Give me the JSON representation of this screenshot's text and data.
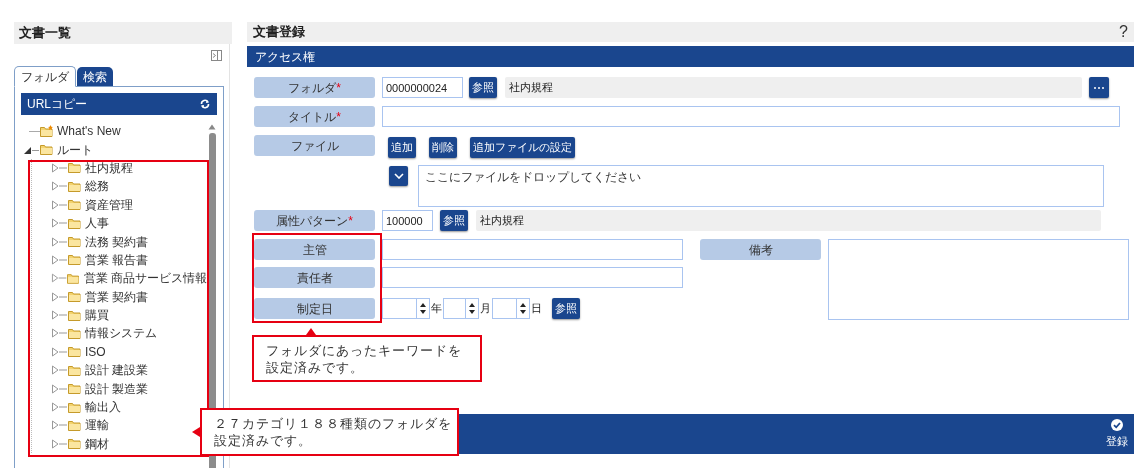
{
  "left_panel": {
    "title": "文書一覧",
    "tabs": [
      {
        "label": "フォルダ",
        "selected": true
      },
      {
        "label": "検索",
        "selected": false
      }
    ],
    "toolbar": {
      "label": "URLコピー"
    },
    "tree": [
      {
        "label": "What's New",
        "kind": "new"
      },
      {
        "label": "ルート",
        "kind": "folder",
        "expanded": true,
        "children": [
          {
            "label": "社内規程",
            "kind": "folder",
            "expanded": false
          },
          {
            "label": "総務",
            "kind": "folder",
            "expanded": false
          },
          {
            "label": "資産管理",
            "kind": "folder",
            "expanded": false
          },
          {
            "label": "人事",
            "kind": "folder",
            "expanded": false
          },
          {
            "label": "法務 契約書",
            "kind": "folder",
            "expanded": false
          },
          {
            "label": "営業 報告書",
            "kind": "folder",
            "expanded": false
          },
          {
            "label": "営業 商品サービス情報",
            "kind": "folder",
            "expanded": false
          },
          {
            "label": "営業 契約書",
            "kind": "folder",
            "expanded": false
          },
          {
            "label": "購買",
            "kind": "folder",
            "expanded": false
          },
          {
            "label": "情報システム",
            "kind": "folder",
            "expanded": false
          },
          {
            "label": "ISO",
            "kind": "folder",
            "expanded": false
          },
          {
            "label": "設計 建設業",
            "kind": "folder",
            "expanded": false
          },
          {
            "label": "設計 製造業",
            "kind": "folder",
            "expanded": false
          },
          {
            "label": "輸出入",
            "kind": "folder",
            "expanded": false
          },
          {
            "label": "運輸",
            "kind": "folder",
            "expanded": false
          },
          {
            "label": "鋼材",
            "kind": "folder",
            "expanded": false
          }
        ]
      }
    ]
  },
  "right_panel": {
    "title": "文書登録",
    "help": "?",
    "section": "アクセス権",
    "folder": {
      "label": "フォルダ",
      "required_mark": "*",
      "value": "0000000024",
      "button": "参照",
      "name": "社内規程"
    },
    "title_field": {
      "label": "タイトル",
      "required_mark": "*"
    },
    "file": {
      "label": "ファイル",
      "buttons": [
        "追加",
        "削除",
        "追加ファイルの設定"
      ],
      "drop_placeholder": "ここにファイルをドロップしてください"
    },
    "attribute": {
      "label": "属性パターン",
      "required_mark": "*",
      "value": "100000",
      "button": "参照",
      "name": "社内規程"
    },
    "keywords": [
      {
        "label": "主管"
      },
      {
        "label": "責任者"
      }
    ],
    "date": {
      "label": "制定日",
      "units": [
        "年",
        "月",
        "日"
      ],
      "button": "参照"
    },
    "remarks": {
      "label": "備考"
    },
    "footer": {
      "button": "登録"
    }
  },
  "annotations": [
    {
      "lines": [
        "フォルダにあったキーワードを",
        "設定済みです。"
      ]
    },
    {
      "lines": [
        "２７カテゴリ１８８種類のフォルダを",
        "設定済みです。"
      ]
    }
  ]
}
